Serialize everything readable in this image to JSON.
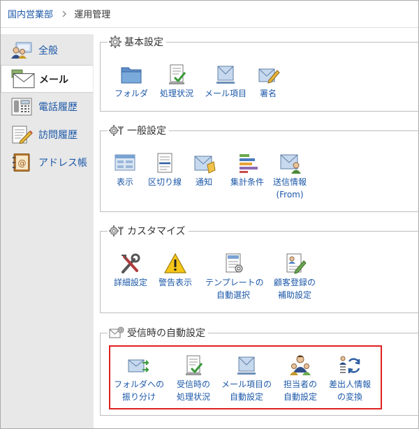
{
  "breadcrumb": {
    "parent": "国内営業部",
    "current": "運用管理"
  },
  "sidebar": {
    "items": [
      {
        "label": "全般",
        "icon": "general-icon",
        "active": false
      },
      {
        "label": "メール",
        "icon": "mail-icon",
        "active": true
      },
      {
        "label": "電話履歴",
        "icon": "phone-icon",
        "active": false
      },
      {
        "label": "訪問履歴",
        "icon": "visit-icon",
        "active": false
      },
      {
        "label": "アドレス帳",
        "icon": "address-book-icon",
        "active": false
      }
    ]
  },
  "sections": {
    "basic": {
      "title": "基本設定",
      "items": [
        {
          "label": "フォルダ",
          "icon": "folder-icon"
        },
        {
          "label": "処理状況",
          "icon": "status-icon"
        },
        {
          "label": "メール項目",
          "icon": "mail-field-icon"
        },
        {
          "label": "署名",
          "icon": "signature-icon"
        }
      ]
    },
    "general": {
      "title": "一般設定",
      "items": [
        {
          "label": "表示",
          "icon": "display-icon"
        },
        {
          "label": "区切り線",
          "icon": "separator-icon"
        },
        {
          "label": "通知",
          "icon": "notify-icon"
        },
        {
          "label": "集計条件",
          "icon": "aggregate-icon"
        },
        {
          "label": "送信情報",
          "label2": "(From)",
          "icon": "sender-info-icon"
        }
      ]
    },
    "customize": {
      "title": "カスタマイズ",
      "items": [
        {
          "label": "詳細設定",
          "icon": "tools-icon"
        },
        {
          "label": "警告表示",
          "icon": "warning-icon"
        },
        {
          "label": "テンプレートの",
          "label2": "自動選択",
          "icon": "template-icon"
        },
        {
          "label": "顧客登録の",
          "label2": "補助設定",
          "icon": "customer-register-icon"
        }
      ]
    },
    "auto": {
      "title": "受信時の自動設定",
      "items": [
        {
          "label": "フォルダへの",
          "label2": "振り分け",
          "icon": "mail-sort-icon"
        },
        {
          "label": "受信時の",
          "label2": "処理状況",
          "icon": "receive-status-icon"
        },
        {
          "label": "メール項目の",
          "label2": "自動設定",
          "icon": "mail-field-auto-icon"
        },
        {
          "label": "担当者の",
          "label2": "自動設定",
          "icon": "assignee-icon"
        },
        {
          "label": "差出人情報",
          "label2": "の変換",
          "icon": "sender-convert-icon"
        }
      ]
    }
  },
  "colors": {
    "link": "#1c58a8",
    "sidebar": "#e8e8e8",
    "highlight": "#e02020"
  }
}
